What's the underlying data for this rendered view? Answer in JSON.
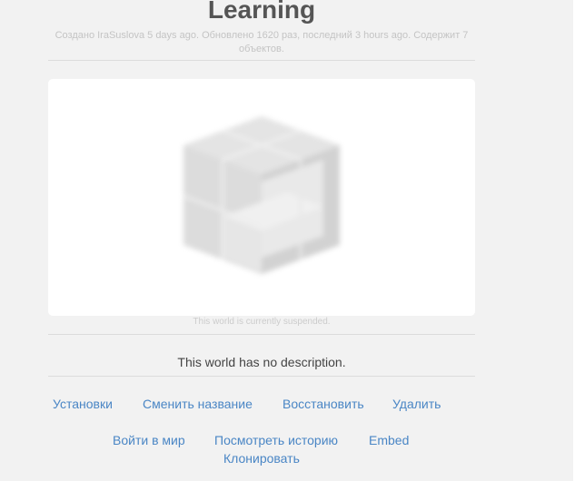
{
  "world": {
    "title": "Learning",
    "meta_text": "Создано IraSuslova 5 days ago. Обновлено 1620 раз, последний 3 hours ago. Содержит 7 объектов.",
    "status_text": "This world is currently suspended.",
    "description": "This world has no description."
  },
  "actions": {
    "settings": "Установки",
    "rename": "Сменить название",
    "restore": "Восстановить",
    "delete": "Удалить",
    "enter_world": "Войти в мир",
    "view_history": "Посмотреть историю",
    "embed": "Embed",
    "clone": "Клонировать"
  },
  "icons": {
    "preview": "blurred-cube-icon"
  },
  "colors": {
    "link": "#4a86c5",
    "title": "#555555",
    "background": "#f2f2f2"
  }
}
